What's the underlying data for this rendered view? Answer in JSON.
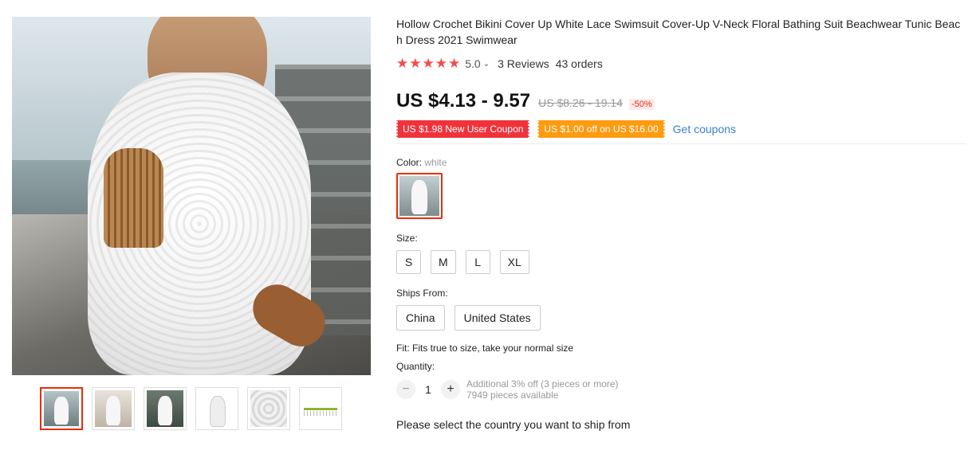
{
  "product": {
    "title": "Hollow Crochet Bikini Cover Up White Lace Swimsuit Cover-Up V-Neck Floral Bathing Suit Beachwear Tunic Beach Dress 2021 Swimwear",
    "rating": {
      "stars": 5,
      "score": "5.0",
      "reviews": "3 Reviews",
      "orders": "43 orders"
    },
    "price": "US $4.13 - 9.57",
    "original_price": "US $8.26 - 19.14",
    "discount": "-50%",
    "coupons": [
      {
        "label": "US $1.98 New User Coupon",
        "color": "#f0333b"
      },
      {
        "label": "US $1.00 off on US $16.00",
        "color": "#fe9b10"
      }
    ],
    "get_coupons": "Get coupons"
  },
  "color": {
    "label": "Color:",
    "selected": "white"
  },
  "size": {
    "label": "Size:",
    "options": [
      "S",
      "M",
      "L",
      "XL"
    ]
  },
  "ships_from": {
    "label": "Ships From:",
    "options": [
      "China",
      "United States"
    ]
  },
  "fit": "Fit: Fits true to size, take your normal size",
  "quantity": {
    "label": "Quantity:",
    "value": "1",
    "discount_note": "Additional 3% off (3 pieces or more)",
    "available": "7949 pieces available"
  },
  "ship_message": "Please select the country you want to ship from",
  "colors": {
    "accent": "#e62e04",
    "star": "#f44a4a",
    "link": "#3a80d0"
  }
}
